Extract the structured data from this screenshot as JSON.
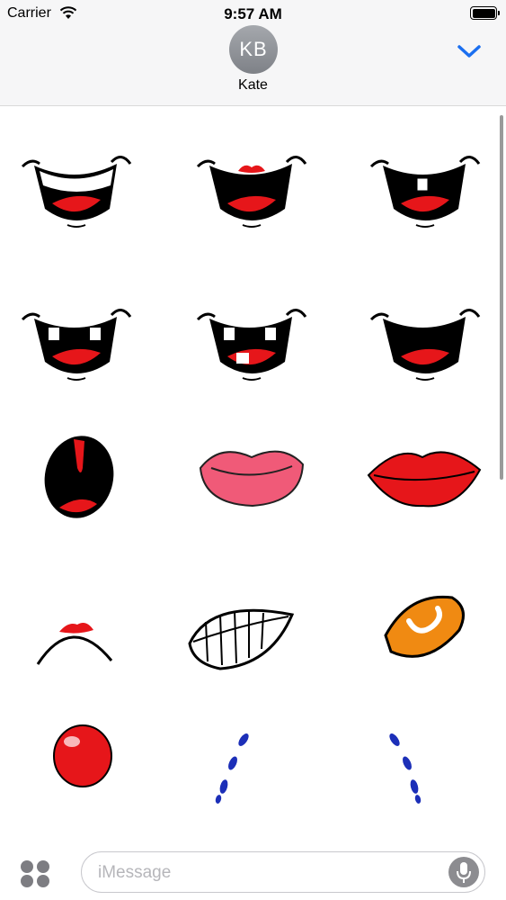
{
  "status": {
    "carrier": "Carrier",
    "time": "9:57 AM"
  },
  "header": {
    "initials": "KB",
    "name": "Kate"
  },
  "compose": {
    "placeholder": "iMessage"
  },
  "stickers": [
    {
      "name": "big-smile-white-teeth-mouth"
    },
    {
      "name": "big-smile-red-lips-mouth"
    },
    {
      "name": "smile-single-tooth-mouth"
    },
    {
      "name": "smile-gap-teeth-mouth"
    },
    {
      "name": "smile-buck-teeth-mouth"
    },
    {
      "name": "open-smile-mouth"
    },
    {
      "name": "surprised-oval-mouth"
    },
    {
      "name": "pink-lips"
    },
    {
      "name": "red-lips"
    },
    {
      "name": "small-frown-mouth"
    },
    {
      "name": "teeth-grin-mouth"
    },
    {
      "name": "orange-o-mouth"
    },
    {
      "name": "red-clown-nose"
    },
    {
      "name": "blue-dashed-brow-left"
    },
    {
      "name": "blue-dashed-brow-right"
    }
  ],
  "colors": {
    "accent": "#1b6ff0",
    "lip_red": "#e6161a",
    "lip_pink": "#f05a78",
    "orange": "#f08a12",
    "blue": "#1c2fb8"
  }
}
